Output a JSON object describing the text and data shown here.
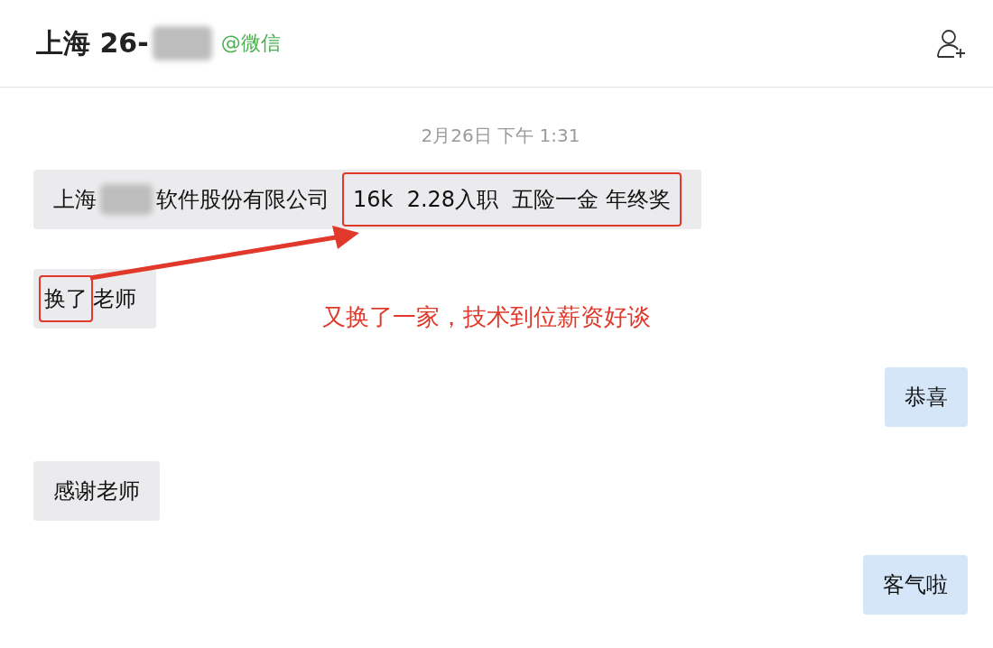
{
  "header": {
    "title": "上海 26-",
    "redacted": true,
    "source": "@微信"
  },
  "timestamp": "2月26日 下午 1:31",
  "messages": [
    {
      "outgoing": false,
      "segments": [
        {
          "kind": "text",
          "text": "上海"
        },
        {
          "kind": "redacted"
        },
        {
          "kind": "text",
          "text": "软件股份有限公司"
        },
        {
          "kind": "boxed",
          "text": "16k  2.28入职  五险一金 年终奖"
        }
      ]
    },
    {
      "outgoing": false,
      "segments": [
        {
          "kind": "boxed",
          "text": "换了"
        },
        {
          "kind": "text",
          "text": "老师"
        }
      ],
      "annotation": "又换了一家，技术到位薪资好谈"
    },
    {
      "outgoing": true,
      "segments": [
        {
          "kind": "text",
          "text": "恭喜"
        }
      ]
    },
    {
      "outgoing": false,
      "segments": [
        {
          "kind": "text",
          "text": "感谢老师"
        }
      ]
    },
    {
      "outgoing": true,
      "segments": [
        {
          "kind": "text",
          "text": "客气啦"
        }
      ]
    }
  ]
}
